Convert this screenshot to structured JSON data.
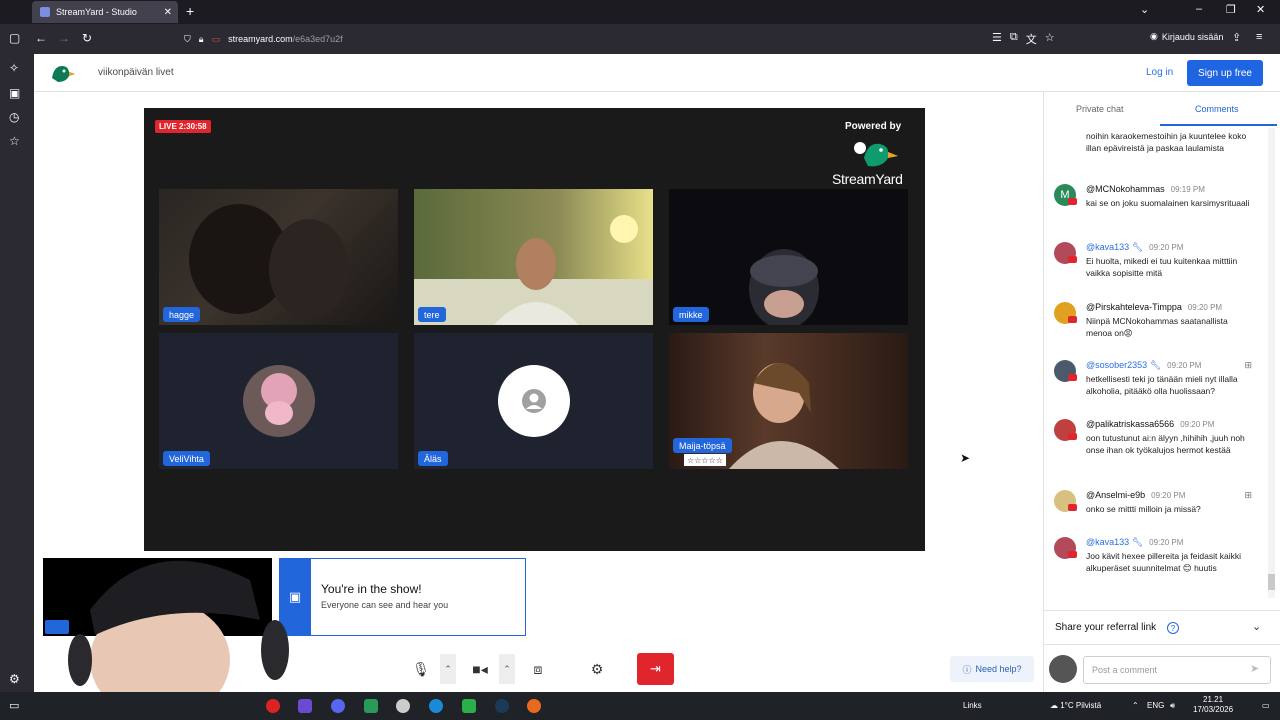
{
  "browser": {
    "tab_title": "StreamYard - Studio",
    "url_domain": "streamyard.com",
    "url_path": "/e6a3ed7u2f",
    "signin_label": "Kirjaudu sisään"
  },
  "header": {
    "show_title": "viikonpäivän livet",
    "login_label": "Log in",
    "signup_label": "Sign up free"
  },
  "stage": {
    "live_badge": "LIVE 2:30:58",
    "powered_by": "Powered by",
    "brand": "StreamYard",
    "participants": [
      {
        "name": "hagge"
      },
      {
        "name": "tere"
      },
      {
        "name": "mikke"
      },
      {
        "name": "VeliVihta"
      },
      {
        "name": "Äläs"
      },
      {
        "name": "Maija-töpsä",
        "stars": "☆☆☆☆☆"
      }
    ]
  },
  "toast": {
    "title": "You're in the show!",
    "subtitle": "Everyone can see and hear you"
  },
  "controls": {
    "need_help": "Need help?"
  },
  "panel": {
    "tab_private": "Private chat",
    "tab_comments": "Comments",
    "first_text": "noihin karaokemestoihin ja kuuntelee koko illan epävireistä ja paskaa laulamista",
    "comments": [
      {
        "author": "@MCNokohammas",
        "time": "09:19 PM",
        "text": "kai se on joku suomalainen karsimysrituaali",
        "mod": false
      },
      {
        "author": "@kava133",
        "time": "09:20 PM",
        "text": "Ei huolta, mikedi ei tuu kuitenkaa mitttiin vaikka sopisitte mitä",
        "mod": true
      },
      {
        "author": "@Pirskahteleva-Timppa",
        "time": "09:20 PM",
        "text": "Niinpä MCNokohammas saatanallista menoa on😡",
        "mod": false
      },
      {
        "author": "@sosober2353",
        "time": "09:20 PM",
        "text": "hetkellisesti teki jo tänään mieli nyt illalla alkoholia, pitääkö olla huolissaan?",
        "mod": true
      },
      {
        "author": "@palikatriskassa6566",
        "time": "09:20 PM",
        "text": "oon tutustunut ai:n älyyn ,hihihih ,juuh noh onse ihan ok työkalujos hermot kestää",
        "mod": false
      },
      {
        "author": "@Anselmi-e9b",
        "time": "09:20 PM",
        "text": "onko se mittti milloin ja missä?",
        "mod": false
      },
      {
        "author": "@kava133",
        "time": "09:20 PM",
        "text": "Joo kävit hexee pillereita ja feidasit kaikki alkuperäset suunnitelmat 😊 huutis",
        "mod": true
      }
    ],
    "referral": "Share your referral link",
    "input_placeholder": "Post a comment"
  },
  "taskbar": {
    "links": "Links",
    "weather": "1°C Pilvistä",
    "lang": "ENG",
    "time": "21.21",
    "date": "17/03/2026"
  }
}
